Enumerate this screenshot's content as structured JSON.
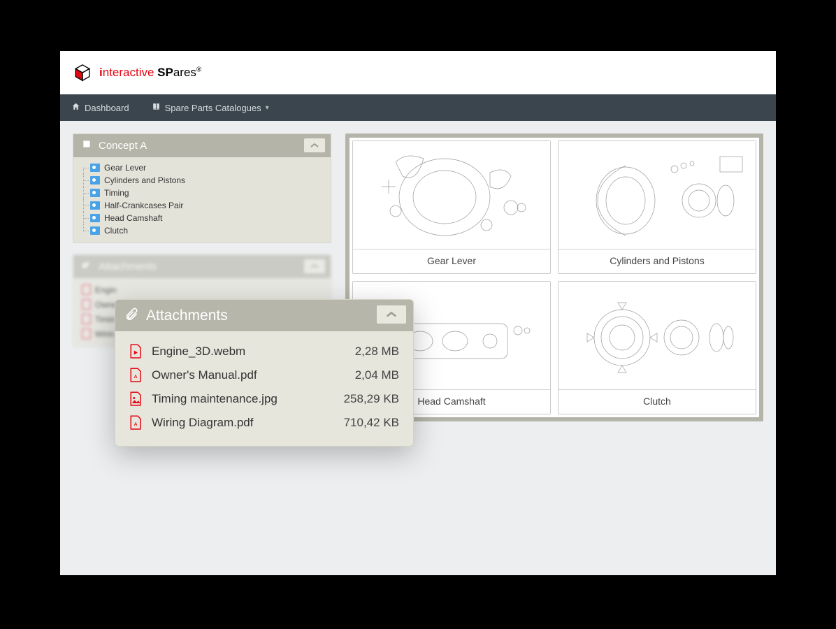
{
  "brand": {
    "i": "i",
    "nteractive": "nteractive",
    "sp": " SP",
    "ares": "ares",
    "reg": "®"
  },
  "nav": {
    "dashboard": "Dashboard",
    "catalogues": "Spare Parts Catalogues"
  },
  "sidebar": {
    "concept_title": "Concept A",
    "items": [
      {
        "label": "Gear Lever"
      },
      {
        "label": "Cylinders and Pistons"
      },
      {
        "label": "Timing"
      },
      {
        "label": "Half-Crankcases Pair"
      },
      {
        "label": "Head Camshaft"
      },
      {
        "label": "Clutch"
      }
    ],
    "attachments_title": "Attachments",
    "bg_attachments": [
      {
        "label": "Engin"
      },
      {
        "label": "Owne"
      },
      {
        "label": "Timin"
      },
      {
        "label": "Wirin"
      }
    ]
  },
  "popover": {
    "title": "Attachments",
    "rows": [
      {
        "icon": "video",
        "name": "Engine_3D.webm",
        "size": "2,28 MB"
      },
      {
        "icon": "pdf",
        "name": "Owner's Manual.pdf",
        "size": "2,04 MB"
      },
      {
        "icon": "img",
        "name": "Timing maintenance.jpg",
        "size": "258,29 KB"
      },
      {
        "icon": "pdf",
        "name": "Wiring Diagram.pdf",
        "size": "710,42 KB"
      }
    ]
  },
  "cards": [
    {
      "label": "Gear Lever"
    },
    {
      "label": "Cylinders and Pistons"
    },
    {
      "label": "Head Camshaft"
    },
    {
      "label": "Clutch"
    }
  ]
}
